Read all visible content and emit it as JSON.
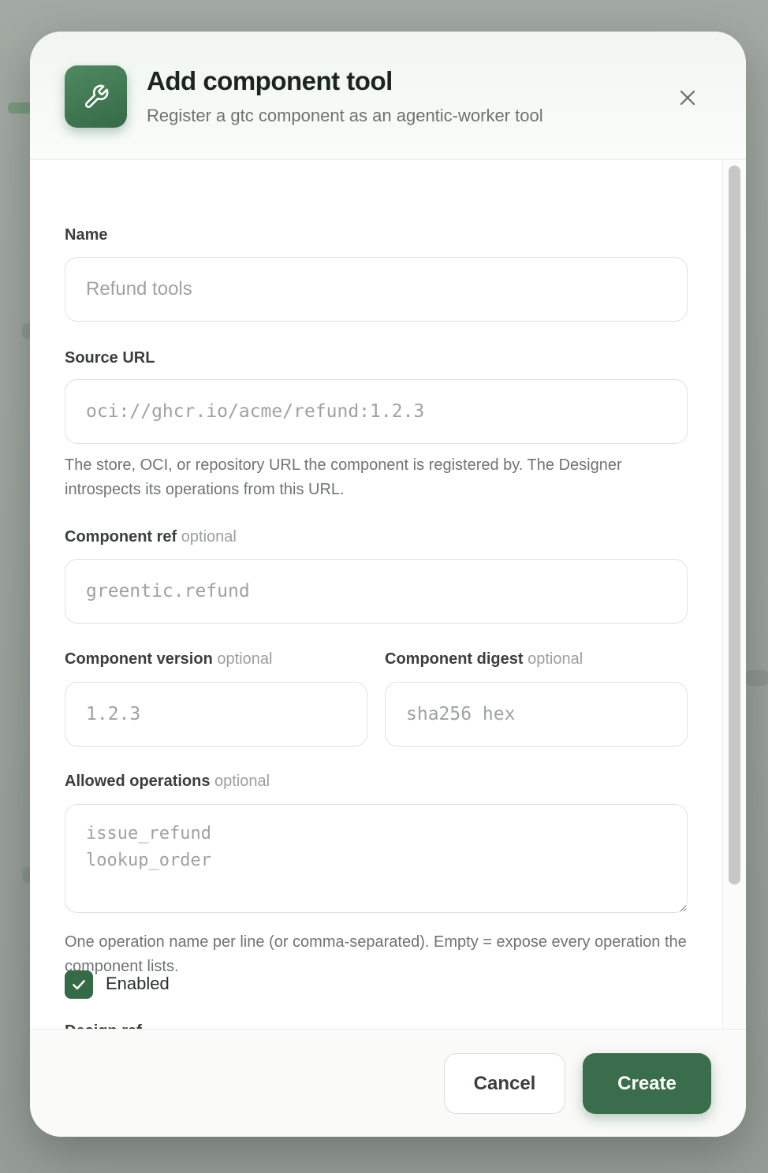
{
  "modal": {
    "title": "Add component tool",
    "subtitle": "Register a gtc component as an agentic-worker tool",
    "header_icon": "wrench-icon",
    "close_icon": "close-icon"
  },
  "form": {
    "name": {
      "label": "Name",
      "placeholder": "Refund tools"
    },
    "source_url": {
      "label": "Source URL",
      "placeholder": "oci://ghcr.io/acme/refund:1.2.3",
      "help": "The store, OCI, or repository URL the component is registered by. The Designer introspects its operations from this URL."
    },
    "component_ref": {
      "label": "Component ref",
      "optional": "optional",
      "placeholder": "greentic.refund"
    },
    "component_version": {
      "label": "Component version",
      "optional": "optional",
      "placeholder": "1.2.3"
    },
    "component_digest": {
      "label": "Component digest",
      "optional": "optional",
      "placeholder": "sha256 hex"
    },
    "allowed_operations": {
      "label": "Allowed operations",
      "optional": "optional",
      "placeholder": "issue_refund\nlookup_order",
      "help": "One operation name per line (or comma-separated). Empty = expose every operation the component lists."
    },
    "enabled": {
      "label": "Enabled",
      "checked": true
    },
    "next_field_label_partial": "Design ref"
  },
  "footer": {
    "cancel_label": "Cancel",
    "create_label": "Create"
  },
  "colors": {
    "accent": "#356a47",
    "accent_button": "#3a6d4b"
  }
}
